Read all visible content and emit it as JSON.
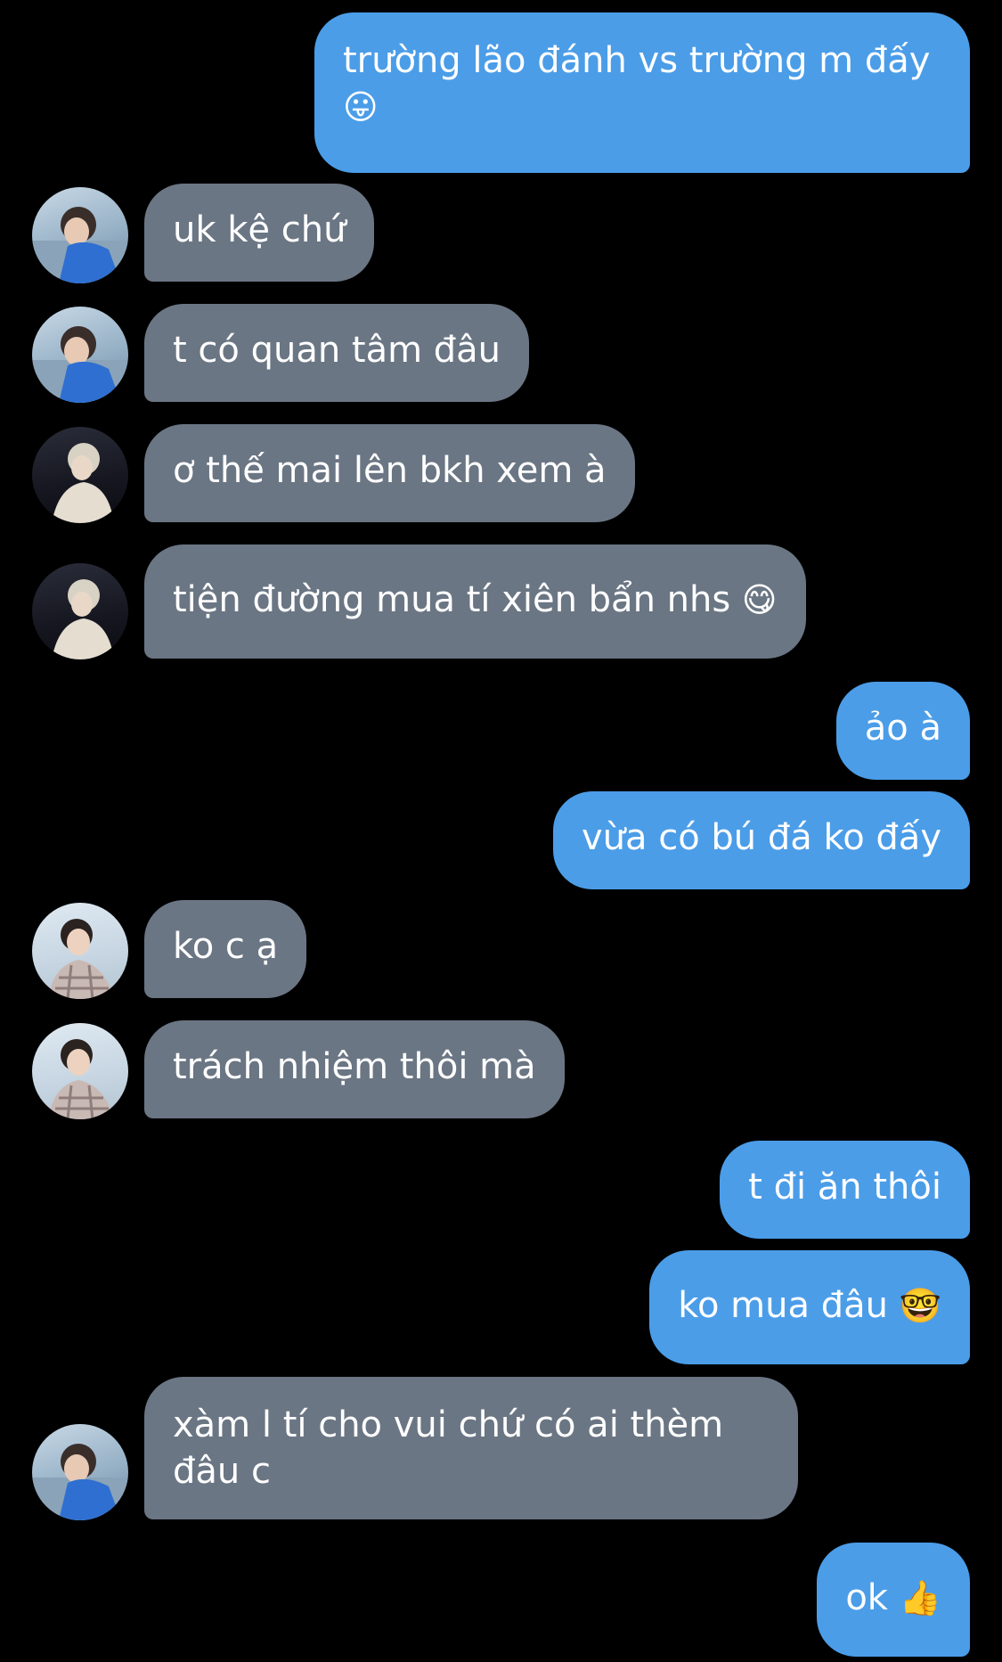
{
  "messages": [
    {
      "side": "sent",
      "text": "trường lão đánh vs trường m đấy",
      "emoji": "😛"
    },
    {
      "side": "received",
      "avatar": "avatar-boy-blue-shirt",
      "text": "uk kệ chứ"
    },
    {
      "side": "received",
      "avatar": "avatar-boy-blue-shirt",
      "text": "t có quan tâm đâu"
    },
    {
      "side": "received",
      "avatar": "avatar-blond-night",
      "text": "ơ thế mai lên bkh xem à"
    },
    {
      "side": "received",
      "avatar": "avatar-blond-night",
      "text": "tiện đường mua tí xiên bẩn nhs",
      "emoji": "😋"
    },
    {
      "side": "sent",
      "text": "ảo à"
    },
    {
      "side": "sent",
      "text": "vừa có bú đá ko đấy"
    },
    {
      "side": "received",
      "avatar": "avatar-boy-plaid",
      "text": "ko c ạ"
    },
    {
      "side": "received",
      "avatar": "avatar-boy-plaid",
      "text": "trách nhiệm thôi mà"
    },
    {
      "side": "sent",
      "text": "t đi ăn thôi"
    },
    {
      "side": "sent",
      "text": "ko mua đâu",
      "emoji": "🤓"
    },
    {
      "side": "received",
      "avatar": "avatar-boy-blue-shirt",
      "text": "xàm l tí cho vui chứ có ai thèm đâu c"
    },
    {
      "side": "sent",
      "text": "ok",
      "emoji": "👍"
    }
  ],
  "colors": {
    "background": "#000000",
    "sent_bubble": "#4b9de8",
    "received_bubble": "#6b7684",
    "text": "#ffffff"
  }
}
